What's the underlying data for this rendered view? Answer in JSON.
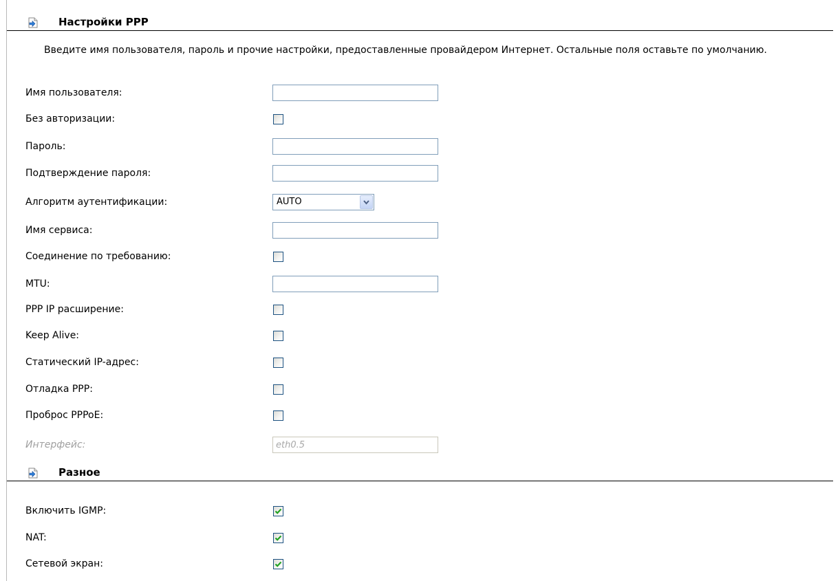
{
  "ppp_section": {
    "title": "Настройки PPP",
    "icon": "section-arrow-icon",
    "intro": "Введите имя пользователя, пароль и прочие настройки, предоставленные провайдером Интернет. Остальные поля оставьте по умолчанию."
  },
  "fields": {
    "username": {
      "label": "Имя пользователя:",
      "value": ""
    },
    "no_auth": {
      "label": "Без авторизации:",
      "checked": false
    },
    "password": {
      "label": "Пароль:",
      "value": ""
    },
    "password_confirm": {
      "label": "Подтверждение пароля:",
      "value": ""
    },
    "auth_algorithm": {
      "label": "Алгоритм аутентификации:",
      "value": "AUTO"
    },
    "service_name": {
      "label": "Имя сервиса:",
      "value": ""
    },
    "on_demand": {
      "label": "Соединение по требованию:",
      "checked": false
    },
    "mtu": {
      "label": "MTU:",
      "value": ""
    },
    "ppp_ip_ext": {
      "label": "PPP IP расширение:",
      "checked": false
    },
    "keep_alive": {
      "label": "Keep Alive:",
      "checked": false
    },
    "static_ip": {
      "label": "Статический IP-адрес:",
      "checked": false
    },
    "ppp_debug": {
      "label": "Отладка PPP:",
      "checked": false
    },
    "pppoe_passthrough": {
      "label": "Проброс PPPoE:",
      "checked": false
    },
    "interface": {
      "label": "Интерфейс:",
      "value": "eth0.5",
      "disabled": true
    }
  },
  "misc_section": {
    "title": "Разное",
    "icon": "section-arrow-icon"
  },
  "misc_fields": {
    "igmp": {
      "label": "Включить IGMP:",
      "checked": true
    },
    "nat": {
      "label": "NAT:",
      "checked": true
    },
    "firewall": {
      "label": "Сетевой экран:",
      "checked": true
    }
  },
  "colors": {
    "check_mark": "#21a121",
    "checkbox_border": "#1c5180",
    "input_border": "#7f9db9"
  }
}
